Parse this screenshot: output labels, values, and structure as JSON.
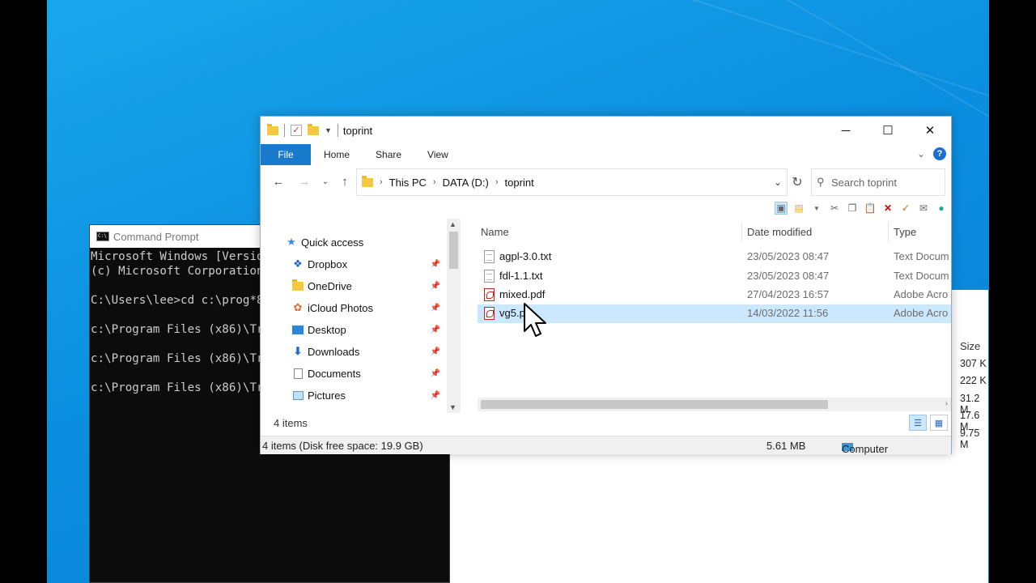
{
  "cmd": {
    "title": "Command Prompt",
    "lines": [
      "Microsoft Windows [Versio",
      "(c) Microsoft Corporation",
      "",
      "C:\\Users\\lee>cd c:\\prog*8",
      "",
      "c:\\Program Files (x86)\\Tr",
      "",
      "c:\\Program Files (x86)\\Tr",
      "",
      "c:\\Program Files (x86)\\Tr"
    ]
  },
  "background_window": {
    "size_header": "Size",
    "sizes": [
      "307 K",
      "222 K",
      "31.2 M",
      "17.6 M",
      "9.75 M"
    ]
  },
  "explorer": {
    "title": "toprint",
    "window_buttons": {
      "minimize": "─",
      "maximize": "☐",
      "close": "✕"
    },
    "ribbon_tabs": [
      "File",
      "Home",
      "Share",
      "View"
    ],
    "breadcrumb": [
      "This PC",
      "DATA (D:)",
      "toprint"
    ],
    "search_placeholder": "Search toprint",
    "nav_items": [
      {
        "label": "Quick access",
        "icon": "star-icon"
      },
      {
        "label": "Dropbox",
        "icon": "dropbox-icon"
      },
      {
        "label": "OneDrive",
        "icon": "folder-icon"
      },
      {
        "label": "iCloud Photos",
        "icon": "icloud-photos-icon"
      },
      {
        "label": "Desktop",
        "icon": "desktop-icon"
      },
      {
        "label": "Downloads",
        "icon": "download-icon"
      },
      {
        "label": "Documents",
        "icon": "documents-icon"
      },
      {
        "label": "Pictures",
        "icon": "pictures-icon"
      }
    ],
    "columns": {
      "name": "Name",
      "date": "Date modified",
      "type": "Type"
    },
    "files": [
      {
        "name": "agpl-3.0.txt",
        "date": "23/05/2023 08:47",
        "type": "Text Docum",
        "kind": "txt"
      },
      {
        "name": "fdl-1.1.txt",
        "date": "23/05/2023 08:47",
        "type": "Text Docum",
        "kind": "txt"
      },
      {
        "name": "mixed.pdf",
        "date": "27/04/2023 16:57",
        "type": "Adobe Acro",
        "kind": "pdf"
      },
      {
        "name": "vg5.p",
        "date": "14/03/2022 11:56",
        "type": "Adobe Acro",
        "kind": "pdf",
        "selected": true
      }
    ],
    "item_count": "4 items",
    "status": {
      "left": "4 items (Disk free space: 19.9 GB)",
      "size": "5.61 MB",
      "location": "Computer"
    }
  }
}
